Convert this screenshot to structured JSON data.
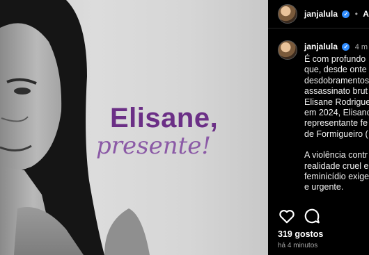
{
  "post": {
    "headline_name": "Elisane,",
    "headline_script": "presente!"
  },
  "panel": {
    "header": {
      "username": "janjalula",
      "separator": "•",
      "follow_fragment": "A"
    },
    "comment": {
      "username": "janjalula",
      "time_fragment": "4 m",
      "lines": [
        "É com profundo",
        "que, desde onte",
        "desdobramentos",
        "assassinato brut",
        "Elisane Rodrigue",
        "em 2024, Elisanc",
        "representante fe",
        "de Formigueiro (",
        "",
        "A violência contr",
        "realidade cruel e",
        "feminicídio exige",
        "e urgente."
      ]
    },
    "likes": "319 gostos",
    "time_ago": "há 4 minutos"
  },
  "colors": {
    "name_purple": "#6b2f86",
    "script_purple": "#8b5aa6",
    "verified_blue": "#2f8cff"
  },
  "icons": {
    "like": "heart-icon",
    "comment": "comment-icon",
    "verified": "verified-badge-icon"
  }
}
